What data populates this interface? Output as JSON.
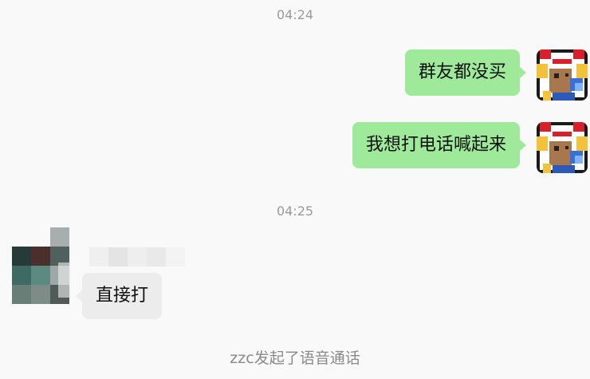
{
  "messages": {
    "ts1": "04:24",
    "msg1": "群友都没买",
    "msg2": "我想打电话喊起来",
    "ts2": "04:25",
    "msg3": "直接打",
    "notice": "zzc发起了语音通话"
  },
  "avatars": {
    "self": "pixel-art-chicken-mascot",
    "other": "pixelated-avatar"
  },
  "colors": {
    "bubble_out": "#9eea9a",
    "bubble_in": "#ececec",
    "background": "#f9f9f9",
    "muted_text": "#9a9a9a"
  }
}
